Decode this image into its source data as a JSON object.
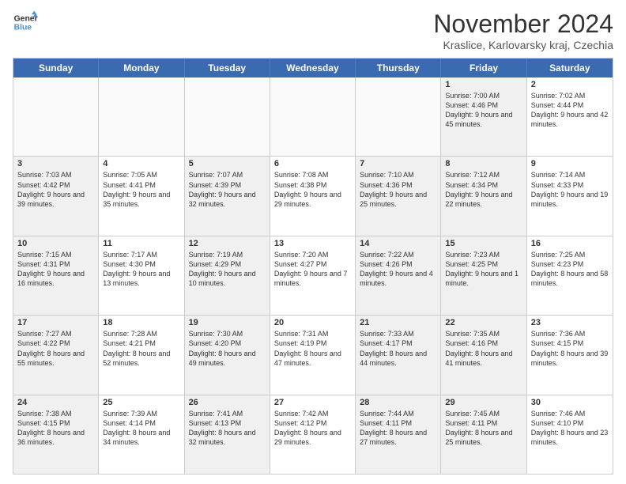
{
  "logo": {
    "line1": "General",
    "line2": "Blue"
  },
  "title": "November 2024",
  "location": "Kraslice, Karlovarsky kraj, Czechia",
  "weekdays": [
    "Sunday",
    "Monday",
    "Tuesday",
    "Wednesday",
    "Thursday",
    "Friday",
    "Saturday"
  ],
  "rows": [
    [
      {
        "day": "",
        "info": "",
        "empty": true
      },
      {
        "day": "",
        "info": "",
        "empty": true
      },
      {
        "day": "",
        "info": "",
        "empty": true
      },
      {
        "day": "",
        "info": "",
        "empty": true
      },
      {
        "day": "",
        "info": "",
        "empty": true
      },
      {
        "day": "1",
        "info": "Sunrise: 7:00 AM\nSunset: 4:46 PM\nDaylight: 9 hours\nand 45 minutes.",
        "shaded": true
      },
      {
        "day": "2",
        "info": "Sunrise: 7:02 AM\nSunset: 4:44 PM\nDaylight: 9 hours\nand 42 minutes."
      }
    ],
    [
      {
        "day": "3",
        "info": "Sunrise: 7:03 AM\nSunset: 4:42 PM\nDaylight: 9 hours\nand 39 minutes.",
        "shaded": true
      },
      {
        "day": "4",
        "info": "Sunrise: 7:05 AM\nSunset: 4:41 PM\nDaylight: 9 hours\nand 35 minutes."
      },
      {
        "day": "5",
        "info": "Sunrise: 7:07 AM\nSunset: 4:39 PM\nDaylight: 9 hours\nand 32 minutes.",
        "shaded": true
      },
      {
        "day": "6",
        "info": "Sunrise: 7:08 AM\nSunset: 4:38 PM\nDaylight: 9 hours\nand 29 minutes."
      },
      {
        "day": "7",
        "info": "Sunrise: 7:10 AM\nSunset: 4:36 PM\nDaylight: 9 hours\nand 25 minutes.",
        "shaded": true
      },
      {
        "day": "8",
        "info": "Sunrise: 7:12 AM\nSunset: 4:34 PM\nDaylight: 9 hours\nand 22 minutes.",
        "shaded": true
      },
      {
        "day": "9",
        "info": "Sunrise: 7:14 AM\nSunset: 4:33 PM\nDaylight: 9 hours\nand 19 minutes."
      }
    ],
    [
      {
        "day": "10",
        "info": "Sunrise: 7:15 AM\nSunset: 4:31 PM\nDaylight: 9 hours\nand 16 minutes.",
        "shaded": true
      },
      {
        "day": "11",
        "info": "Sunrise: 7:17 AM\nSunset: 4:30 PM\nDaylight: 9 hours\nand 13 minutes."
      },
      {
        "day": "12",
        "info": "Sunrise: 7:19 AM\nSunset: 4:29 PM\nDaylight: 9 hours\nand 10 minutes.",
        "shaded": true
      },
      {
        "day": "13",
        "info": "Sunrise: 7:20 AM\nSunset: 4:27 PM\nDaylight: 9 hours\nand 7 minutes."
      },
      {
        "day": "14",
        "info": "Sunrise: 7:22 AM\nSunset: 4:26 PM\nDaylight: 9 hours\nand 4 minutes.",
        "shaded": true
      },
      {
        "day": "15",
        "info": "Sunrise: 7:23 AM\nSunset: 4:25 PM\nDaylight: 9 hours\nand 1 minute.",
        "shaded": true
      },
      {
        "day": "16",
        "info": "Sunrise: 7:25 AM\nSunset: 4:23 PM\nDaylight: 8 hours\nand 58 minutes."
      }
    ],
    [
      {
        "day": "17",
        "info": "Sunrise: 7:27 AM\nSunset: 4:22 PM\nDaylight: 8 hours\nand 55 minutes.",
        "shaded": true
      },
      {
        "day": "18",
        "info": "Sunrise: 7:28 AM\nSunset: 4:21 PM\nDaylight: 8 hours\nand 52 minutes."
      },
      {
        "day": "19",
        "info": "Sunrise: 7:30 AM\nSunset: 4:20 PM\nDaylight: 8 hours\nand 49 minutes.",
        "shaded": true
      },
      {
        "day": "20",
        "info": "Sunrise: 7:31 AM\nSunset: 4:19 PM\nDaylight: 8 hours\nand 47 minutes."
      },
      {
        "day": "21",
        "info": "Sunrise: 7:33 AM\nSunset: 4:17 PM\nDaylight: 8 hours\nand 44 minutes.",
        "shaded": true
      },
      {
        "day": "22",
        "info": "Sunrise: 7:35 AM\nSunset: 4:16 PM\nDaylight: 8 hours\nand 41 minutes.",
        "shaded": true
      },
      {
        "day": "23",
        "info": "Sunrise: 7:36 AM\nSunset: 4:15 PM\nDaylight: 8 hours\nand 39 minutes."
      }
    ],
    [
      {
        "day": "24",
        "info": "Sunrise: 7:38 AM\nSunset: 4:15 PM\nDaylight: 8 hours\nand 36 minutes.",
        "shaded": true
      },
      {
        "day": "25",
        "info": "Sunrise: 7:39 AM\nSunset: 4:14 PM\nDaylight: 8 hours\nand 34 minutes."
      },
      {
        "day": "26",
        "info": "Sunrise: 7:41 AM\nSunset: 4:13 PM\nDaylight: 8 hours\nand 32 minutes.",
        "shaded": true
      },
      {
        "day": "27",
        "info": "Sunrise: 7:42 AM\nSunset: 4:12 PM\nDaylight: 8 hours\nand 29 minutes."
      },
      {
        "day": "28",
        "info": "Sunrise: 7:44 AM\nSunset: 4:11 PM\nDaylight: 8 hours\nand 27 minutes.",
        "shaded": true
      },
      {
        "day": "29",
        "info": "Sunrise: 7:45 AM\nSunset: 4:11 PM\nDaylight: 8 hours\nand 25 minutes.",
        "shaded": true
      },
      {
        "day": "30",
        "info": "Sunrise: 7:46 AM\nSunset: 4:10 PM\nDaylight: 8 hours\nand 23 minutes."
      }
    ]
  ]
}
